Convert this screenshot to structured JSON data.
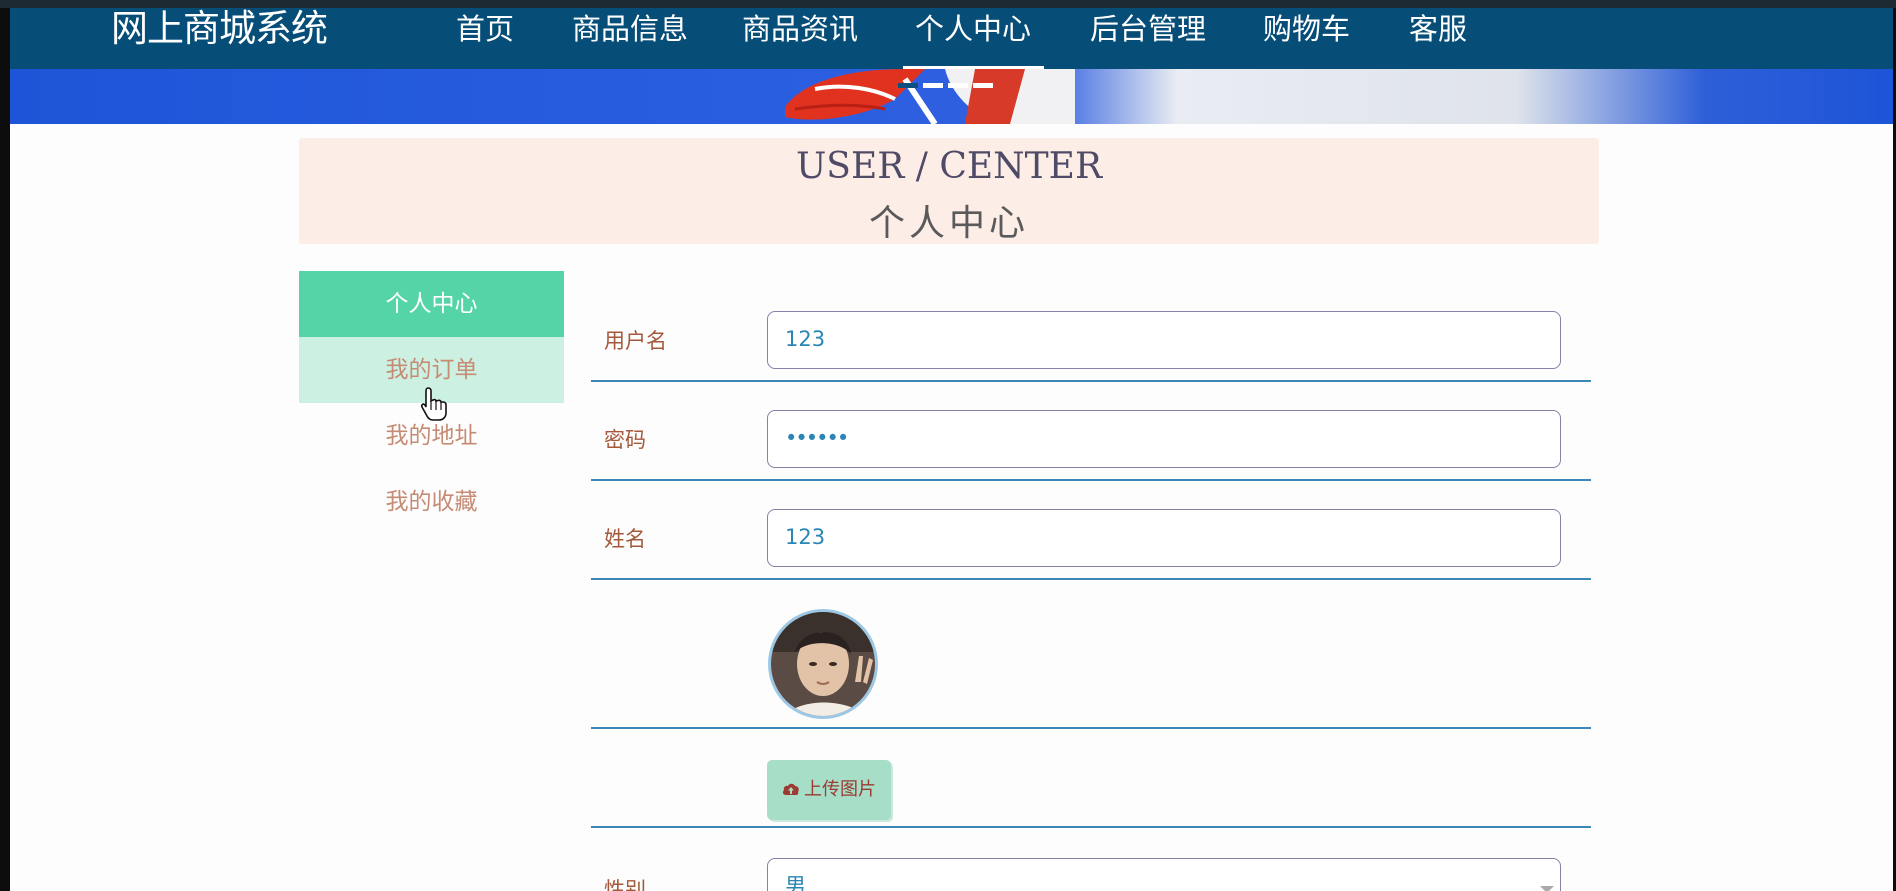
{
  "brand": "网上商城系统",
  "nav": {
    "items": [
      {
        "label": "首页"
      },
      {
        "label": "商品信息"
      },
      {
        "label": "商品资讯"
      },
      {
        "label": "个人中心"
      },
      {
        "label": "后台管理"
      },
      {
        "label": "购物车"
      },
      {
        "label": "客服"
      }
    ],
    "active_index": 3
  },
  "banner": {
    "slide_indicator_count": 4,
    "active_slide": 1
  },
  "title": {
    "en": "USER / CENTER",
    "cn": "个人中心"
  },
  "sidebar": {
    "items": [
      {
        "label": "个人中心"
      },
      {
        "label": "我的订单"
      },
      {
        "label": "我的地址"
      },
      {
        "label": "我的收藏"
      }
    ],
    "active_index": 0,
    "hover_index": 1
  },
  "form": {
    "username": {
      "label": "用户名",
      "value": "123"
    },
    "password": {
      "label": "密码",
      "value": "••••••"
    },
    "name": {
      "label": "姓名",
      "value": "123"
    },
    "upload": {
      "label": "上传图片"
    },
    "gender": {
      "label": "性别",
      "value": "男"
    }
  },
  "colors": {
    "header": "#064e78",
    "sidebar_active": "#55d4a8",
    "sidebar_hover": "#ccf1e2",
    "title_box": "#fceee6",
    "row_line": "#3d87b6"
  }
}
